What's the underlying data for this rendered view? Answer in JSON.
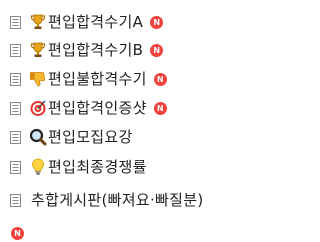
{
  "menu": {
    "items": [
      {
        "label": "편입합격수기A",
        "emoji": "trophy-icon",
        "new": "N"
      },
      {
        "label": "편입합격수기B",
        "emoji": "trophy-icon",
        "new": "N"
      },
      {
        "label": "편입불합격수기",
        "emoji": "thumbs-down-icon",
        "new": "N"
      },
      {
        "label": "편입합격인증샷",
        "emoji": "target-icon",
        "new": "N"
      },
      {
        "label": "편입모집요강",
        "emoji": "magnifier-icon",
        "new": ""
      },
      {
        "label": "편입최종경쟁률",
        "emoji": "lightbulb-icon",
        "new": ""
      },
      {
        "label": "추합게시판(빠져요·빠질분)",
        "emoji": "",
        "new": ""
      }
    ],
    "footer_badge": "N"
  },
  "colors": {
    "badge": "#f0413c",
    "text": "#222222",
    "doc_icon": "#8a8a8a"
  }
}
